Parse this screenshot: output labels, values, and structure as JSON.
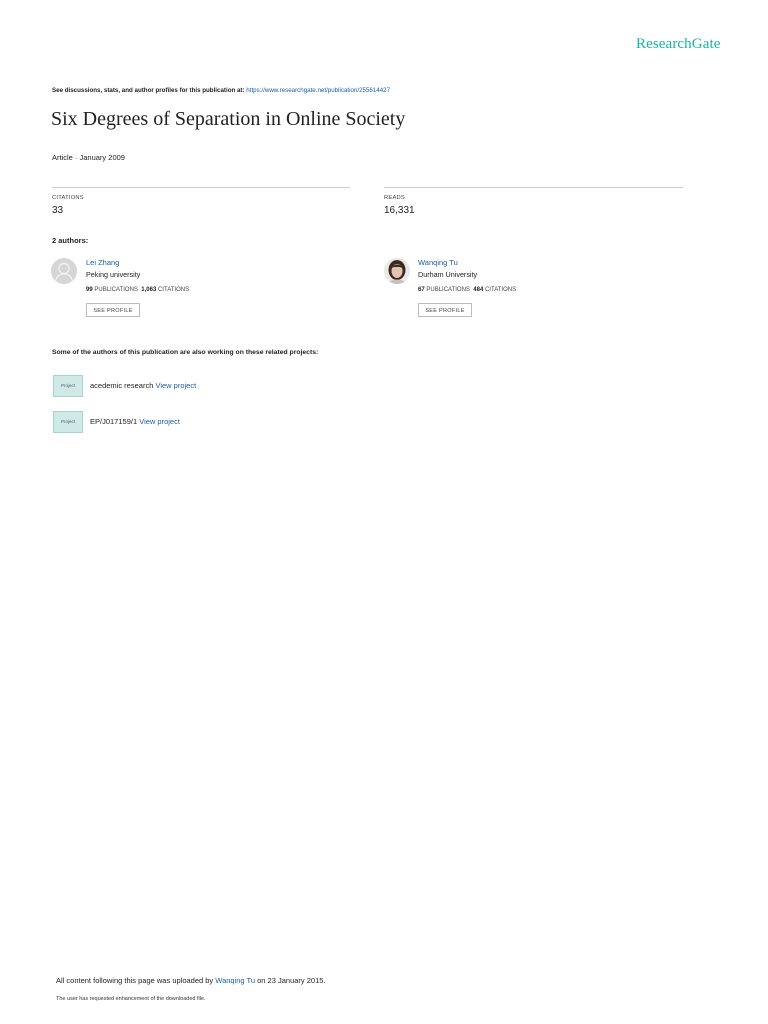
{
  "brand": {
    "logo": "ResearchGate"
  },
  "header": {
    "intro": "See discussions, stats, and author profiles for this publication at:",
    "url": "https://www.researchgate.net/publication/255614427"
  },
  "publication": {
    "title": "Six Degrees of Separation in Online Society",
    "meta": "Article · January 2009"
  },
  "stats": {
    "citations_label": "CITATIONS",
    "citations": "33",
    "reads_label": "READS",
    "reads": "16,331"
  },
  "authors_label": "2 authors:",
  "authors": [
    {
      "name": "Lei Zhang",
      "institution": "Peking university",
      "publications": "99",
      "publications_label": "PUBLICATIONS",
      "citations": "1,063",
      "citations_label": "CITATIONS",
      "button": "SEE PROFILE",
      "avatar": "default-avatar-icon"
    },
    {
      "name": "Wanqing Tu",
      "institution": "Durham University",
      "publications": "67",
      "publications_label": "PUBLICATIONS",
      "citations": "484",
      "citations_label": "CITATIONS",
      "button": "SEE PROFILE",
      "avatar": "portrait-photo"
    }
  ],
  "projects_label": "Some of the authors of this publication are also working on these related projects:",
  "projects": [
    {
      "icon_label": "Project",
      "name": "acedemic research",
      "link": "View project"
    },
    {
      "icon_label": "Project",
      "name": "EP/J017159/1",
      "link": "View project"
    }
  ],
  "footer": {
    "uploaded_prefix": "All content following this page was uploaded by",
    "uploader": "Wanqing Tu",
    "uploaded_suffix": "on 23 January 2015.",
    "note": "The user has requested enhancement of the downloaded file."
  },
  "colors": {
    "brand": "#19b3a6",
    "link": "#1a5ea8"
  }
}
